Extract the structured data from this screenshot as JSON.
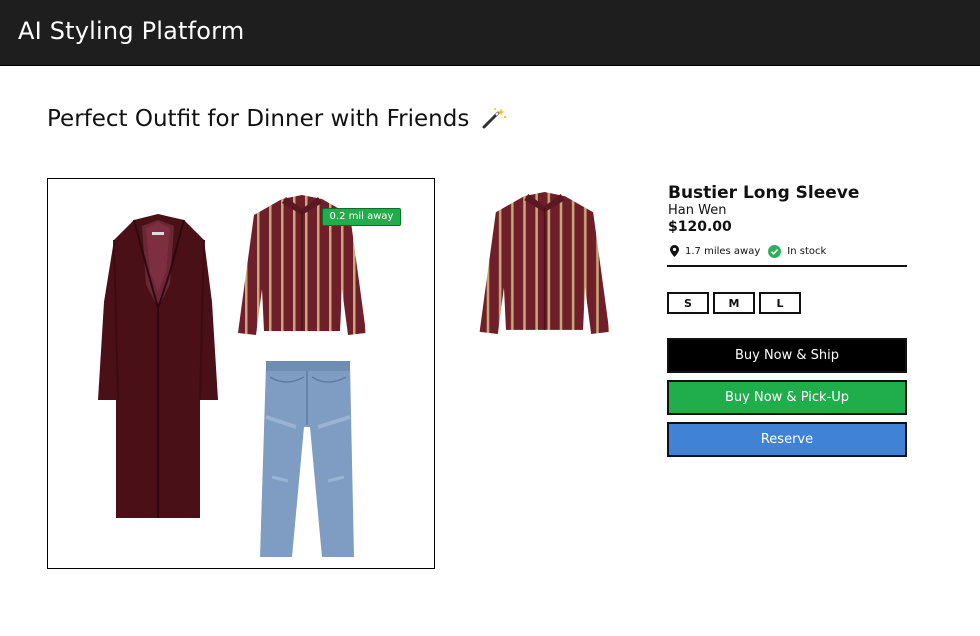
{
  "header": {
    "title": "AI Styling Platform"
  },
  "page": {
    "title": "Perfect Outfit for Dinner with Friends",
    "title_icon": "magic-wand-icon"
  },
  "outfit": {
    "items": [
      "coat",
      "striped-shirt",
      "jeans"
    ],
    "distance_badge": "0.2 mil away"
  },
  "product": {
    "name": "Bustier Long Sleeve",
    "brand": "Han Wen",
    "price": "$120.00",
    "distance": "1.7 miles away",
    "stock": "In stock",
    "sizes": [
      "S",
      "M",
      "L"
    ]
  },
  "actions": {
    "buy_ship": "Buy Now & Ship",
    "buy_pickup": "Buy Now & Pick-Up",
    "reserve": "Reserve"
  },
  "colors": {
    "header_bg": "#1e1e1e",
    "accent_green": "#1fae4b",
    "reserve_blue": "#3f82d6",
    "coat": "#4a1018",
    "shirt_stripe": "#6e1f2a",
    "denim": "#7f9dc2"
  }
}
